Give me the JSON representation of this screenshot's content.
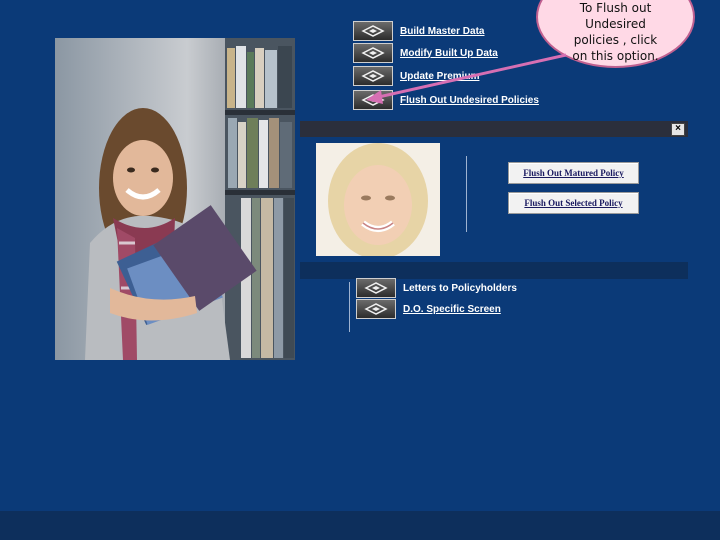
{
  "menu": {
    "top_items": [
      {
        "label": "Build Master Data"
      },
      {
        "label": "Modify Built Up Data"
      },
      {
        "label": "Update Premium"
      },
      {
        "label": "Flush Out Undesired Policies"
      }
    ],
    "bottom_items": [
      {
        "label": "Letters to Policyholders"
      },
      {
        "label": "D.O. Specific Screen"
      }
    ],
    "icon_name": "diamond-nav-icon"
  },
  "callout": {
    "line1": "To Flush out",
    "line2": "Undesired",
    "line3": "policies , click",
    "line4": "on this option."
  },
  "dialog": {
    "close_label": "×",
    "button1": "Flush Out Matured Policy",
    "button2": "Flush Out Selected Policy"
  },
  "colors": {
    "background": "#0b3a78",
    "callout_fill": "#ffd9e6",
    "arrow": "#d66fb3"
  }
}
